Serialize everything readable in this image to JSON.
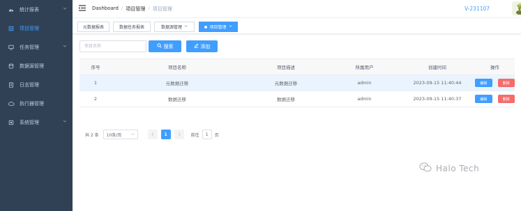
{
  "sidebar": {
    "items": [
      {
        "label": "统计报表",
        "icon": "gauge-icon",
        "chevron": true,
        "active": false
      },
      {
        "label": "项目管理",
        "icon": "project-icon",
        "chevron": false,
        "active": true
      },
      {
        "label": "任务管理",
        "icon": "monitor-icon",
        "chevron": true,
        "active": false
      },
      {
        "label": "数据源管理",
        "icon": "database-icon",
        "chevron": false,
        "active": false
      },
      {
        "label": "日志管理",
        "icon": "document-icon",
        "chevron": false,
        "active": false
      },
      {
        "label": "执行器管理",
        "icon": "cloud-icon",
        "chevron": false,
        "active": false
      },
      {
        "label": "系统管理",
        "icon": "settings-icon",
        "chevron": true,
        "active": false
      }
    ]
  },
  "header": {
    "breadcrumb": [
      "Dashboard",
      "项目管理",
      "项目管理"
    ],
    "version": "V-231107"
  },
  "tags": [
    {
      "label": "元数据报表",
      "active": false
    },
    {
      "label": "数据任务报表",
      "active": false
    },
    {
      "label": "数据源管理",
      "active": false,
      "closable": true
    },
    {
      "label": "项目管理",
      "active": true,
      "closable": true
    }
  ],
  "search": {
    "placeholder": "项目名称",
    "search_label": "搜索",
    "add_label": "添加"
  },
  "table": {
    "columns": [
      "序号",
      "项目名称",
      "项目描述",
      "所属用户",
      "创建时间",
      "操作"
    ],
    "rows": [
      {
        "index": "1",
        "name": "元数据迁移",
        "desc": "元数据迁移",
        "user": "admin",
        "created": "2023-09-15 11:40:44"
      },
      {
        "index": "2",
        "name": "数据迁移",
        "desc": "数据迁移",
        "user": "admin",
        "created": "2023-09-15 11:40:37"
      }
    ],
    "edit_label": "编辑",
    "delete_label": "删除"
  },
  "pagination": {
    "total": "共 2 条",
    "page_size": "10条/页",
    "current_page": "1",
    "goto_label": "前往",
    "goto_value": "1",
    "page_suffix": "页"
  },
  "watermark": "Halo Tech",
  "colors": {
    "sidebar_bg": "#304156",
    "primary": "#409eff",
    "danger": "#f56c6c"
  }
}
